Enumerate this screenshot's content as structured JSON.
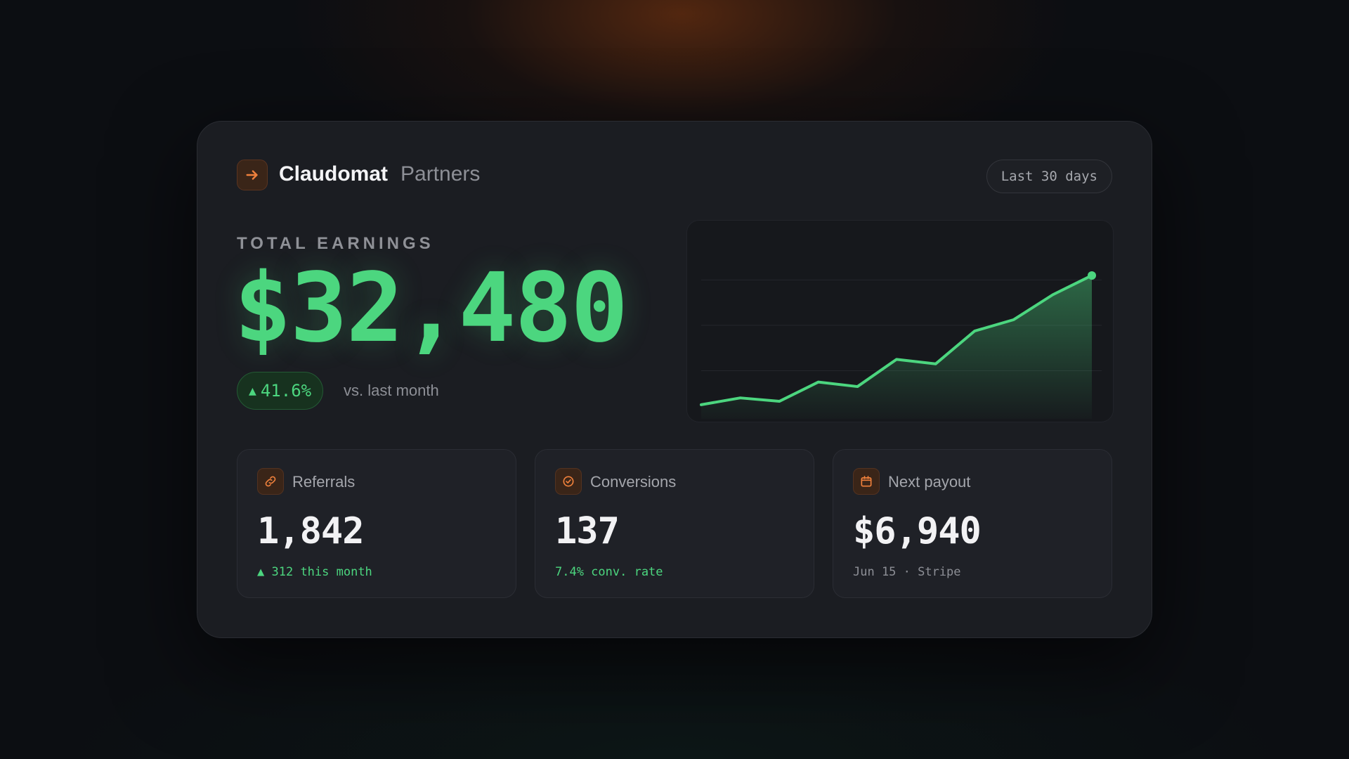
{
  "brand": {
    "name": "Claudomat",
    "section": "Partners",
    "icon": "arrow-right-icon",
    "accent": "#f0813c"
  },
  "date_range": {
    "label": "Last 30 days"
  },
  "earnings": {
    "label": "TOTAL EARNINGS",
    "value": "$32,480",
    "delta_arrow": "▲",
    "delta": "41.6%",
    "delta_note": "vs. last month",
    "positive_color": "#4cd67f"
  },
  "chart_data": {
    "type": "area",
    "x": [
      1,
      2,
      3,
      4,
      5,
      6,
      7,
      8,
      9,
      10,
      11
    ],
    "values": [
      1.0,
      1.6,
      1.3,
      3.0,
      2.6,
      5.0,
      4.6,
      7.5,
      8.5,
      10.7,
      12.4
    ],
    "ylim": [
      0,
      15
    ],
    "grid": true,
    "legend": "none",
    "line_color": "#4cd67f"
  },
  "stats": [
    {
      "icon": "link-icon",
      "title": "Referrals",
      "value": "1,842",
      "sub_arrow": "▲",
      "sub": "312 this month"
    },
    {
      "icon": "check-circle-icon",
      "title": "Conversions",
      "value": "137",
      "sub": "7.4% conv. rate"
    },
    {
      "icon": "calendar-icon",
      "title": "Next payout",
      "value": "$6,940",
      "sub": "Jun 15 · Stripe"
    }
  ]
}
